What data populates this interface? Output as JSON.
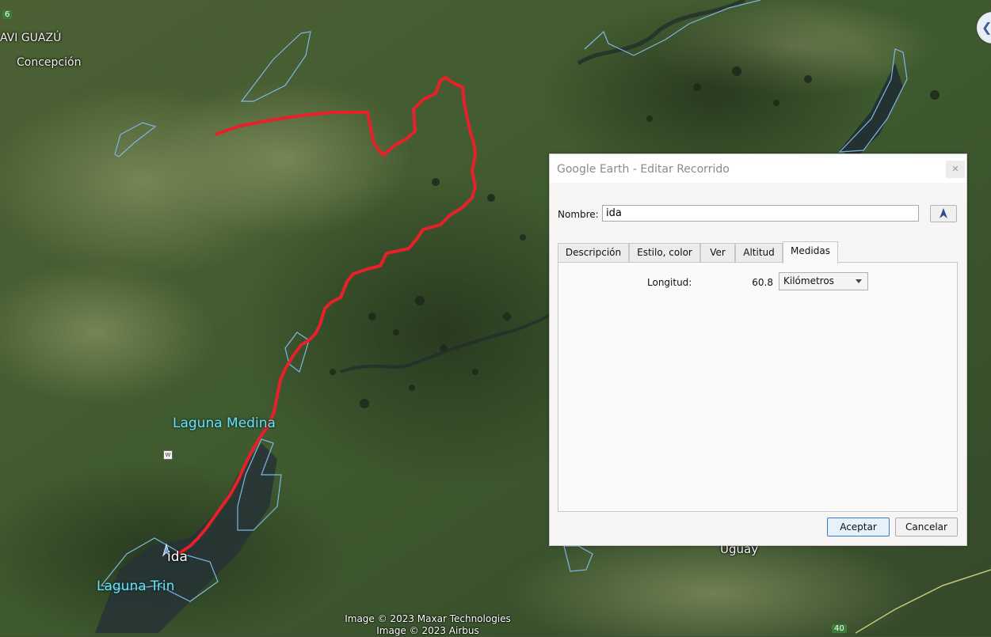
{
  "map": {
    "place_labels": [
      "AVI GUAZÚ",
      "Concepción"
    ],
    "water_labels": [
      "Laguna Medina",
      "Laguna Trin"
    ],
    "uguay_label": "Uguay",
    "route_label": "ida",
    "route_shields": [
      "6",
      "40"
    ],
    "poi_icon": "W",
    "attribution": [
      "Image © 2023 Maxar Technologies",
      "Image © 2023 Airbus"
    ],
    "route_color": "#e8202a",
    "boundary_color": "#7fb6e6",
    "nav_icon": "chevron-left-icon"
  },
  "dialog": {
    "title": "Google Earth - Editar Recorrido",
    "close_icon": "close-icon",
    "name_label": "Nombre:",
    "name_value": "ida",
    "style_icon": "path-style-icon",
    "tabs": [
      "Descripción",
      "Estilo, color",
      "Ver",
      "Altitud",
      "Medidas"
    ],
    "active_tab": "Medidas",
    "measure": {
      "label": "Longitud:",
      "value": "60.8",
      "unit": "Kilómetros"
    },
    "ok_label": "Aceptar",
    "cancel_label": "Cancelar"
  }
}
